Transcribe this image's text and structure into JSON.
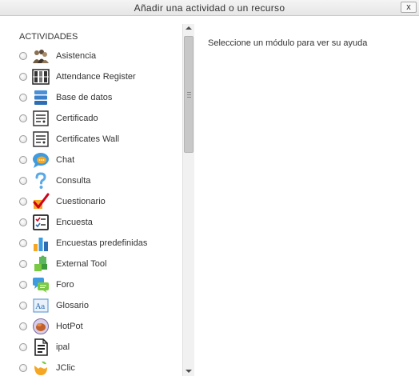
{
  "dialog": {
    "title": "Añadir una actividad o un recurso",
    "close_label": "x"
  },
  "activities": {
    "header": "ACTIVIDADES",
    "items": [
      {
        "label": "Asistencia",
        "icon": "attendance-people-icon"
      },
      {
        "label": "Attendance Register",
        "icon": "register-grid-icon"
      },
      {
        "label": "Base de datos",
        "icon": "database-icon"
      },
      {
        "label": "Certificado",
        "icon": "certificate-icon"
      },
      {
        "label": "Certificates Wall",
        "icon": "certificate-icon"
      },
      {
        "label": "Chat",
        "icon": "chat-bubble-icon"
      },
      {
        "label": "Consulta",
        "icon": "question-mark-icon"
      },
      {
        "label": "Cuestionario",
        "icon": "checkmark-icon"
      },
      {
        "label": "Encuesta",
        "icon": "survey-checklist-icon"
      },
      {
        "label": "Encuestas predefinidas",
        "icon": "bar-chart-icon"
      },
      {
        "label": "External Tool",
        "icon": "puzzle-piece-icon"
      },
      {
        "label": "Foro",
        "icon": "forum-icon"
      },
      {
        "label": "Glosario",
        "icon": "glossary-book-icon"
      },
      {
        "label": "HotPot",
        "icon": "hotpot-icon"
      },
      {
        "label": "ipal",
        "icon": "document-icon"
      },
      {
        "label": "JClic",
        "icon": "jclic-icon"
      }
    ]
  },
  "help": {
    "text": "Seleccione un módulo para ver su ayuda"
  }
}
